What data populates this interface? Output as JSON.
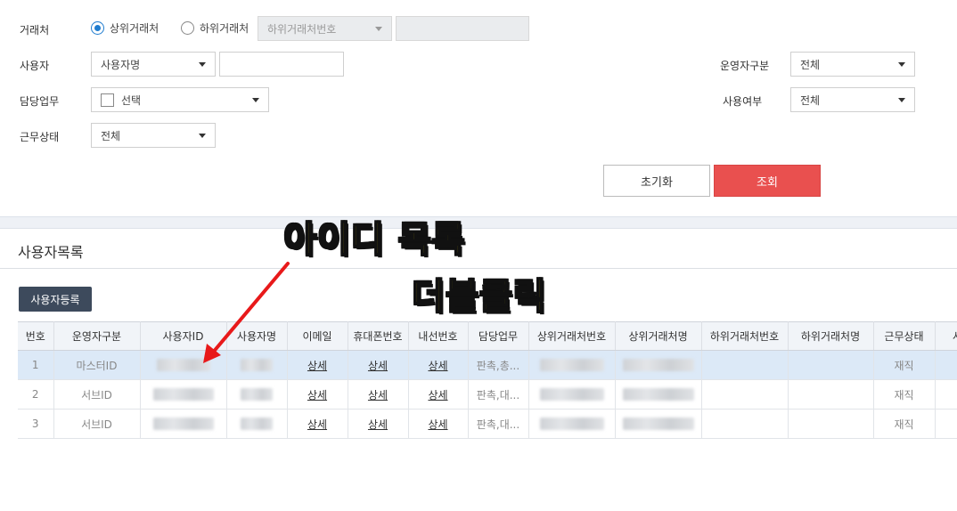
{
  "filters": {
    "partner_label": "거래처",
    "radio_upper": "상위거래처",
    "radio_lower": "하위거래처",
    "lower_number_select": "하위거래처번호",
    "user_label": "사용자",
    "user_select": "사용자명",
    "duty_label": "담당업무",
    "duty_select": "선택",
    "work_status_label": "근무상태",
    "work_status_select": "전체",
    "operator_type_label": "운영자구분",
    "operator_type_select": "전체",
    "use_status_label": "사용여부",
    "use_status_select": "전체"
  },
  "buttons": {
    "reset": "초기화",
    "search": "조회",
    "register": "사용자등록"
  },
  "list_title": "사용자목록",
  "annotation": {
    "line1": "아이디 목록",
    "line2": "더블클릭"
  },
  "table": {
    "headers": [
      "번호",
      "운영자구분",
      "사용자ID",
      "사용자명",
      "이메일",
      "휴대폰번호",
      "내선번호",
      "담당업무",
      "상위거래처번호",
      "상위거래처명",
      "하위거래처번호",
      "하위거래처명",
      "근무상태",
      "사"
    ],
    "rows": [
      {
        "no": "1",
        "type": "마스터ID",
        "email": "상세",
        "phone": "상세",
        "ext": "상세",
        "duty": "판촉,총...",
        "status": "재직"
      },
      {
        "no": "2",
        "type": "서브ID",
        "email": "상세",
        "phone": "상세",
        "ext": "상세",
        "duty": "판촉,대...",
        "status": "재직"
      },
      {
        "no": "3",
        "type": "서브ID",
        "email": "상세",
        "phone": "상세",
        "ext": "상세",
        "duty": "판촉,대...",
        "status": "재직"
      }
    ]
  },
  "colors": {
    "accent": "#1f7ccf",
    "search_button": "#e9504f",
    "register_button": "#3d4a5c",
    "selected_row": "#dce9f7",
    "annotation_text": "#ffe600",
    "annotation_arrow": "#e8191a"
  }
}
